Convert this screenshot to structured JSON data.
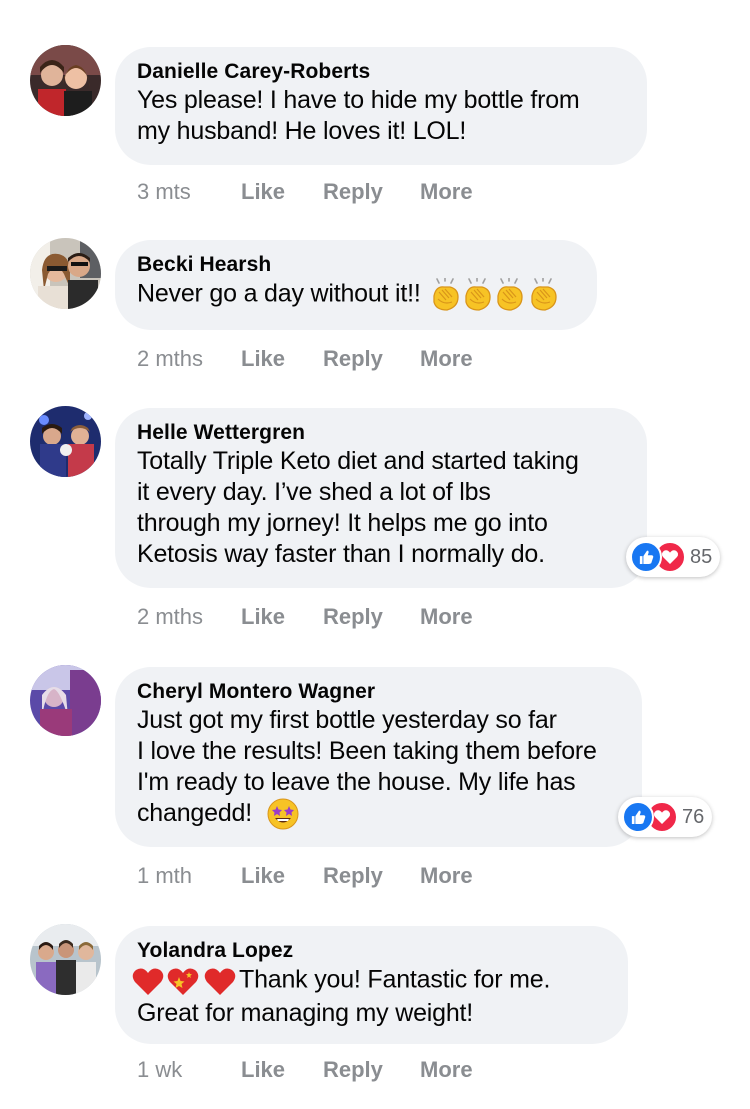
{
  "comments": [
    {
      "author": "Danielle Carey-Roberts",
      "lines": [
        "Yes please! I have to hide my bottle from",
        "my husband! He loves it! LOL!"
      ],
      "time": "3 mts",
      "actions": {
        "like": "Like",
        "reply": "Reply",
        "more": "More"
      }
    },
    {
      "author": "Becki Hearsh",
      "lines": [
        "Never go a day without it!!"
      ],
      "emoji": "clapping-hands-icon",
      "time": "2 mths",
      "actions": {
        "like": "Like",
        "reply": "Reply",
        "more": "More"
      }
    },
    {
      "author": "Helle Wettergren",
      "lines": [
        "Totally Triple Keto diet and started taking",
        "it every day. I’ve shed a lot of lbs",
        "through my jorney! It helps me go into",
        "Ketosis way faster than I normally do."
      ],
      "time": "2 mths",
      "reactions": "85",
      "actions": {
        "like": "Like",
        "reply": "Reply",
        "more": "More"
      }
    },
    {
      "author": "Cheryl Montero Wagner",
      "lines": [
        "Just got my first bottle yesterday so far",
        "I love the results! Been taking them before",
        "I'm ready to leave the house. My life has",
        "changedd!"
      ],
      "emoji": "star-struck-icon",
      "time": "1 mth",
      "reactions": "76",
      "actions": {
        "like": "Like",
        "reply": "Reply",
        "more": "More"
      }
    },
    {
      "author": "Yolandra Lopez",
      "lines": [
        "Thank you! Fantastic for me.",
        "Great for managing my weight!"
      ],
      "emoji": "heart-icons",
      "time": "1 wk",
      "actions": {
        "like": "Like",
        "reply": "Reply",
        "more": "More"
      }
    }
  ],
  "colors": {
    "bubble": "#f0f2f5",
    "like_blue": "#1877f2",
    "love_red": "#f02849",
    "meta_gray": "#8a8d91"
  }
}
